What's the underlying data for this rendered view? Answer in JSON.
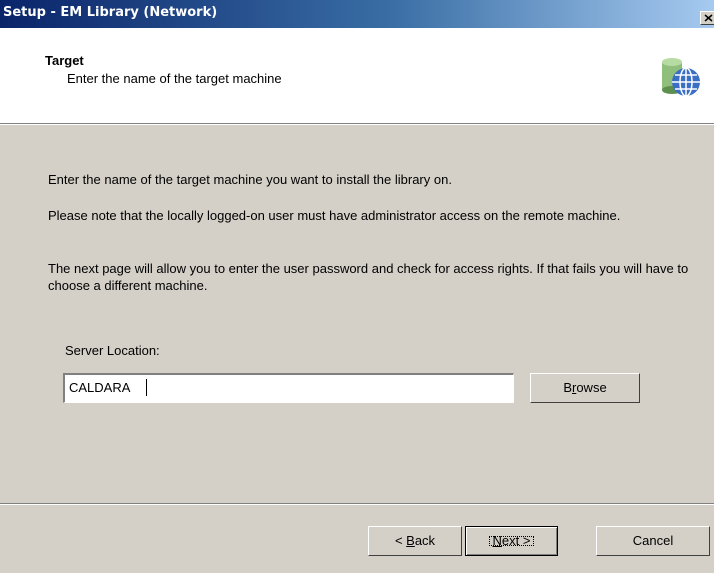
{
  "window": {
    "title": "Setup - EM Library (Network)"
  },
  "header": {
    "title": "Target",
    "subtitle": "Enter the name of the target machine",
    "icon": "globe-database-icon"
  },
  "body": {
    "paragraph1": "Enter the name of the target machine you want to install the library on.",
    "paragraph2": "Please note that the locally logged-on user must have administrator access on the remote machine.",
    "paragraph3": "The next page will allow you to enter the user password and check for access rights. If that fails you will have to choose a different machine."
  },
  "server": {
    "label": "Server Location:",
    "value": "CALDARA",
    "browse_label_pre": "B",
    "browse_label_accel": "r",
    "browse_label_post": "owse"
  },
  "footer": {
    "back_pre": "< ",
    "back_accel": "B",
    "back_post": "ack",
    "next_accel": "N",
    "next_post": "ext >",
    "cancel_label": "Cancel"
  },
  "colors": {
    "titlebar_start": "#0a246a",
    "titlebar_end": "#a6caf0",
    "dialog_face": "#d4d0c8"
  }
}
